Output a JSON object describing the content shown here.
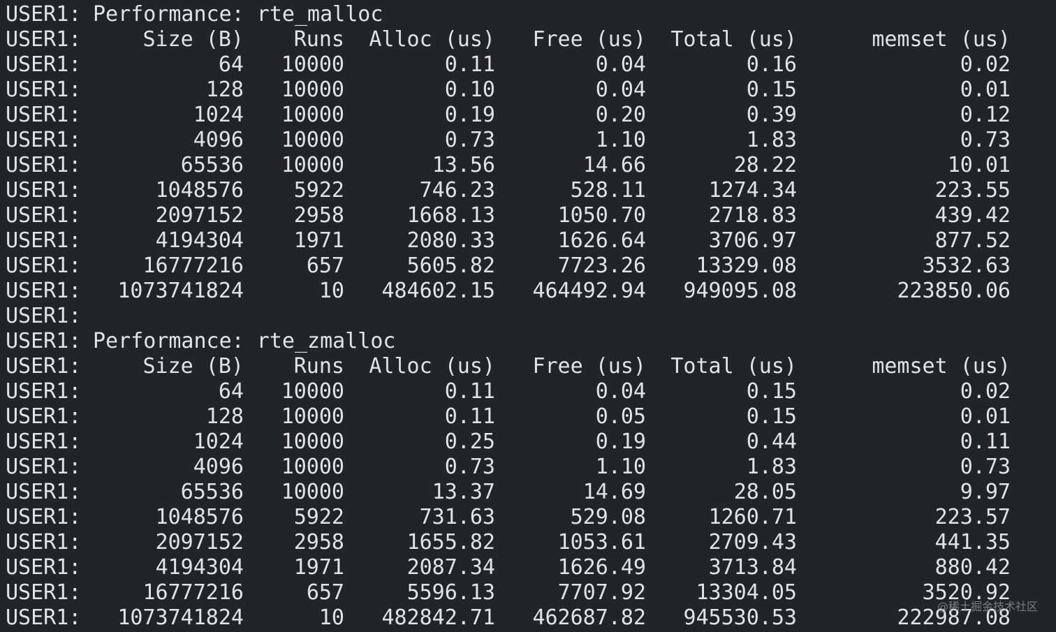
{
  "prefix": "USER1:",
  "sections": [
    {
      "title": "Performance: rte_malloc",
      "headers": [
        "Size (B)",
        "Runs",
        "Alloc (us)",
        "Free (us)",
        "Total (us)",
        "memset (us)"
      ],
      "rows": [
        [
          "64",
          "10000",
          "0.11",
          "0.04",
          "0.16",
          "0.02"
        ],
        [
          "128",
          "10000",
          "0.10",
          "0.04",
          "0.15",
          "0.01"
        ],
        [
          "1024",
          "10000",
          "0.19",
          "0.20",
          "0.39",
          "0.12"
        ],
        [
          "4096",
          "10000",
          "0.73",
          "1.10",
          "1.83",
          "0.73"
        ],
        [
          "65536",
          "10000",
          "13.56",
          "14.66",
          "28.22",
          "10.01"
        ],
        [
          "1048576",
          "5922",
          "746.23",
          "528.11",
          "1274.34",
          "223.55"
        ],
        [
          "2097152",
          "2958",
          "1668.13",
          "1050.70",
          "2718.83",
          "439.42"
        ],
        [
          "4194304",
          "1971",
          "2080.33",
          "1626.64",
          "3706.97",
          "877.52"
        ],
        [
          "16777216",
          "657",
          "5605.82",
          "7723.26",
          "13329.08",
          "3532.63"
        ],
        [
          "1073741824",
          "10",
          "484602.15",
          "464492.94",
          "949095.08",
          "223850.06"
        ]
      ]
    },
    {
      "title": "Performance: rte_zmalloc",
      "headers": [
        "Size (B)",
        "Runs",
        "Alloc (us)",
        "Free (us)",
        "Total (us)",
        "memset (us)"
      ],
      "rows": [
        [
          "64",
          "10000",
          "0.11",
          "0.04",
          "0.15",
          "0.02"
        ],
        [
          "128",
          "10000",
          "0.11",
          "0.05",
          "0.15",
          "0.01"
        ],
        [
          "1024",
          "10000",
          "0.25",
          "0.19",
          "0.44",
          "0.11"
        ],
        [
          "4096",
          "10000",
          "0.73",
          "1.10",
          "1.83",
          "0.73"
        ],
        [
          "65536",
          "10000",
          "13.37",
          "14.69",
          "28.05",
          "9.97"
        ],
        [
          "1048576",
          "5922",
          "731.63",
          "529.08",
          "1260.71",
          "223.57"
        ],
        [
          "2097152",
          "2958",
          "1655.82",
          "1053.61",
          "2709.43",
          "441.35"
        ],
        [
          "4194304",
          "1971",
          "2087.34",
          "1626.49",
          "3713.84",
          "880.42"
        ],
        [
          "16777216",
          "657",
          "5596.13",
          "7707.92",
          "13304.05",
          "3520.92"
        ],
        [
          "1073741824",
          "10",
          "482842.71",
          "462687.82",
          "945530.53",
          "222987.08"
        ]
      ]
    }
  ],
  "watermark": "@稀土掘金技术社区"
}
